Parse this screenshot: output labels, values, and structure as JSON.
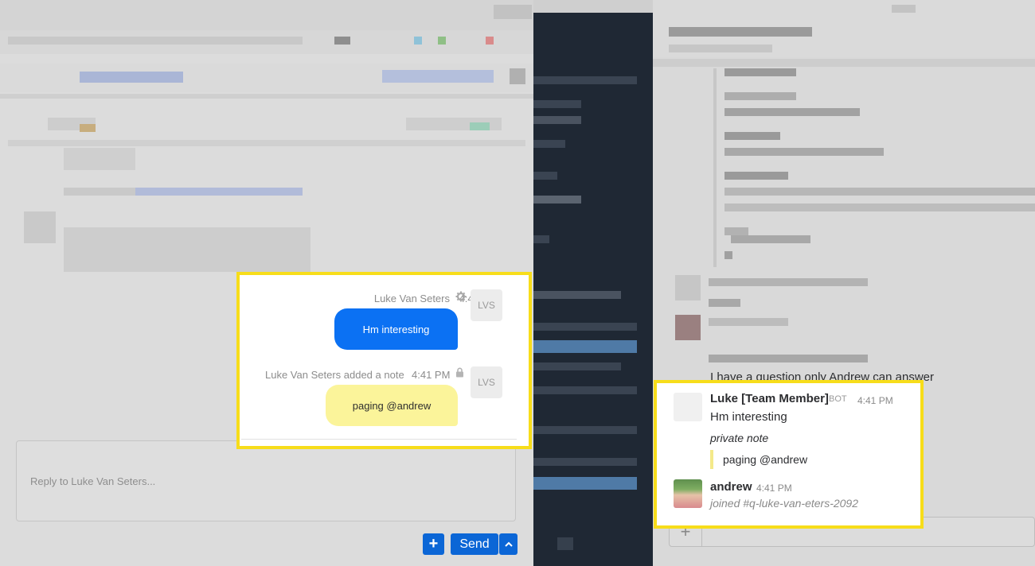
{
  "left_chat": {
    "msg1_sender": "Luke Van Seters",
    "msg1_time": "4:41 PM",
    "msg1_text": "Hm interesting",
    "avatar_initials": "LVS",
    "msg2_meta": "Luke Van Seters added a note",
    "msg2_time": "4:41 PM",
    "msg2_text": "paging @andrew",
    "reply_placeholder": "Reply to Luke Van Seters...",
    "send_label": "Send",
    "add_label": "+",
    "icons": {
      "settings": "gear-icon",
      "lock": "lock-icon",
      "dropdown": "chevron-up-icon"
    }
  },
  "slack": {
    "partial_message": "I have a question only Andrew can answer",
    "bot_name": "Luke [Team Member]",
    "bot_badge": "BOT",
    "bot_time": "4:41 PM",
    "bot_text": "Hm interesting",
    "note_label": "private note",
    "note_text": "paging @andrew",
    "user_name": "andrew",
    "user_time": "4:41 PM",
    "user_text": "joined #q-luke-van-eters-2092",
    "composer_add": "+"
  },
  "colors": {
    "highlight": "#f7dd1a",
    "blue_bubble": "#0b71f3",
    "yellow_bubble": "#fbf49a",
    "sidebar": "#1f2834",
    "send": "#0b66d6"
  }
}
